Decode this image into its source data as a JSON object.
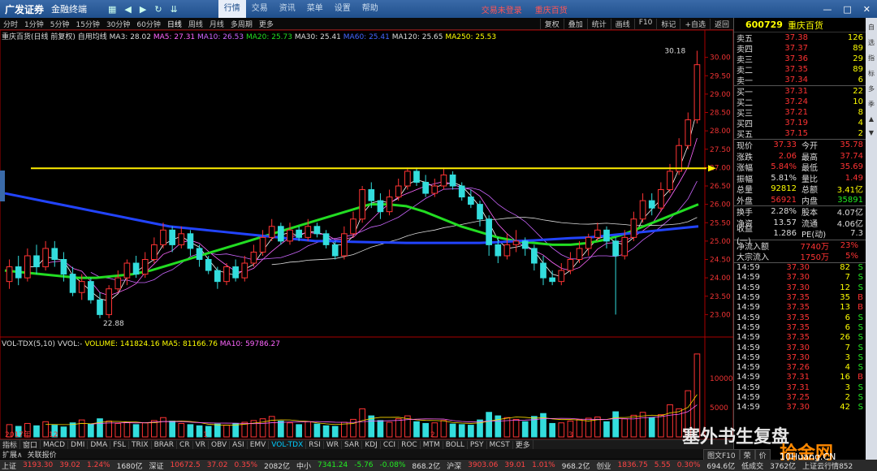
{
  "titlebar": {
    "brand": "广发证券",
    "product": "金融终端",
    "menus": [
      "行情",
      "交易",
      "资讯",
      "菜单",
      "设置",
      "帮助"
    ],
    "notice": "交易未登录",
    "stock": "重庆百货"
  },
  "toolbar": {
    "periods": [
      "分时",
      "1分钟",
      "5分钟",
      "15分钟",
      "30分钟",
      "60分钟",
      "日线",
      "周线",
      "月线",
      "多周期",
      "更多"
    ],
    "actions": [
      "复权",
      "叠加",
      "统计",
      "画线",
      "F10",
      "标记",
      "+自选",
      "返回"
    ]
  },
  "main_header": {
    "name": "重庆百货(日线 前复权)",
    "indicator": "自用均线",
    "ma3": "MA3: 28.02",
    "ma5": "MA5: 27.31",
    "ma10": "MA10: 26.53",
    "ma20": "MA20: 25.73",
    "ma30": "MA30: 25.41",
    "ma60": "MA60: 25.41",
    "ma120": "MA120: 25.65",
    "ma250": "MA250: 25.53"
  },
  "vol_header": {
    "name": "VOL-TDX(5,10)",
    "vvol": "VVOL:-",
    "volume": "VOLUME: 141824.16",
    "ma5": "MA5: 81166.76",
    "ma10": "MA10: 59786.27"
  },
  "chart_data": {
    "type": "candlestick",
    "ylim": [
      22.5,
      30.5
    ],
    "yticks": [
      "30.00",
      "29.50",
      "29.00",
      "28.50",
      "28.00",
      "27.50",
      "27.00",
      "26.50",
      "26.00",
      "25.50",
      "25.00",
      "24.50",
      "24.00",
      "23.50",
      "23.00"
    ],
    "high_label": "30.18",
    "low_label": "22.88",
    "price_line": 26.98,
    "vol_yticks": [
      "10000",
      "5000"
    ],
    "x_labels": [
      "2017年",
      "12",
      "1",
      "2",
      "3"
    ],
    "candles": [
      [
        23.9,
        24.3,
        24.5,
        23.7
      ],
      [
        24.3,
        24.0,
        24.6,
        23.8
      ],
      [
        24.0,
        24.6,
        24.8,
        23.9
      ],
      [
        24.6,
        24.3,
        24.9,
        24.1
      ],
      [
        24.3,
        24.8,
        25.0,
        24.2
      ],
      [
        24.8,
        24.5,
        25.0,
        24.3
      ],
      [
        24.5,
        24.1,
        24.7,
        23.9
      ],
      [
        24.1,
        23.6,
        24.3,
        23.5
      ],
      [
        23.6,
        23.9,
        24.1,
        23.4
      ],
      [
        23.9,
        23.4,
        24.0,
        23.3
      ],
      [
        23.4,
        23.0,
        23.6,
        22.9
      ],
      [
        23.0,
        23.7,
        23.8,
        22.9
      ],
      [
        23.7,
        24.0,
        24.2,
        23.6
      ],
      [
        24.0,
        24.4,
        24.5,
        23.8
      ],
      [
        24.4,
        24.1,
        24.6,
        24.0
      ],
      [
        24.1,
        24.5,
        24.7,
        24.0
      ],
      [
        24.5,
        24.9,
        25.1,
        24.4
      ],
      [
        24.9,
        25.3,
        25.5,
        24.8
      ],
      [
        25.3,
        24.9,
        25.4,
        24.7
      ],
      [
        24.9,
        25.2,
        25.4,
        24.8
      ],
      [
        25.2,
        24.8,
        25.3,
        24.6
      ],
      [
        24.8,
        24.5,
        24.9,
        24.3
      ],
      [
        24.5,
        24.2,
        24.6,
        24.1
      ],
      [
        24.2,
        23.9,
        24.3,
        23.7
      ],
      [
        23.9,
        24.3,
        24.4,
        23.8
      ],
      [
        24.3,
        24.0,
        24.5,
        23.9
      ],
      [
        24.0,
        24.4,
        24.6,
        23.9
      ],
      [
        24.4,
        24.7,
        24.9,
        24.3
      ],
      [
        24.7,
        25.1,
        25.3,
        24.6
      ],
      [
        25.1,
        25.4,
        25.6,
        25.0
      ],
      [
        25.4,
        25.0,
        25.5,
        24.9
      ],
      [
        25.0,
        25.3,
        25.5,
        24.9
      ],
      [
        25.3,
        25.1,
        25.4,
        25.0
      ],
      [
        25.1,
        25.4,
        25.6,
        25.0
      ],
      [
        25.4,
        25.2,
        25.5,
        25.1
      ],
      [
        25.2,
        24.9,
        25.3,
        24.8
      ],
      [
        24.9,
        24.6,
        25.0,
        24.5
      ],
      [
        24.6,
        25.2,
        25.4,
        24.5
      ],
      [
        25.2,
        25.6,
        25.8,
        25.1
      ],
      [
        25.6,
        26.4,
        26.5,
        25.5
      ],
      [
        26.4,
        26.1,
        26.6,
        25.9
      ],
      [
        26.1,
        25.8,
        26.3,
        25.6
      ],
      [
        25.8,
        26.2,
        26.4,
        25.7
      ],
      [
        26.2,
        26.5,
        26.7,
        26.1
      ],
      [
        26.5,
        26.9,
        27.0,
        26.4
      ],
      [
        26.9,
        26.6,
        27.0,
        26.5
      ],
      [
        26.6,
        26.3,
        26.8,
        26.2
      ],
      [
        26.3,
        26.5,
        26.7,
        26.2
      ],
      [
        26.5,
        26.8,
        27.0,
        26.4
      ],
      [
        26.8,
        26.5,
        26.9,
        26.4
      ],
      [
        26.5,
        26.2,
        26.6,
        26.1
      ],
      [
        26.2,
        26.0,
        26.4,
        25.9
      ],
      [
        26.0,
        25.6,
        26.1,
        25.4
      ],
      [
        25.6,
        24.9,
        25.7,
        24.6
      ],
      [
        24.9,
        24.6,
        25.1,
        24.4
      ],
      [
        24.6,
        24.9,
        25.2,
        24.5
      ],
      [
        24.9,
        25.0,
        25.3,
        24.7
      ],
      [
        25.0,
        24.8,
        25.1,
        24.6
      ],
      [
        24.8,
        24.4,
        24.9,
        24.2
      ],
      [
        24.4,
        24.0,
        24.6,
        23.8
      ],
      [
        24.0,
        23.9,
        24.2,
        23.8
      ],
      [
        23.9,
        24.2,
        24.4,
        23.8
      ],
      [
        24.2,
        24.5,
        24.7,
        24.1
      ],
      [
        24.5,
        24.8,
        25.0,
        24.4
      ],
      [
        24.8,
        25.1,
        25.2,
        24.6
      ],
      [
        25.1,
        25.3,
        25.5,
        25.0
      ],
      [
        25.3,
        25.0,
        25.4,
        24.8
      ],
      [
        25.0,
        24.6,
        25.1,
        23.0
      ],
      [
        24.6,
        25.1,
        25.3,
        24.5
      ],
      [
        25.1,
        25.6,
        25.8,
        25.0
      ],
      [
        25.6,
        26.1,
        26.3,
        25.5
      ],
      [
        26.1,
        25.9,
        26.3,
        25.7
      ],
      [
        25.9,
        26.4,
        26.6,
        25.8
      ],
      [
        26.4,
        26.9,
        27.1,
        26.3
      ],
      [
        26.9,
        27.6,
        27.8,
        26.8
      ],
      [
        27.6,
        28.3,
        28.5,
        27.5
      ],
      [
        28.3,
        29.8,
        30.18,
        28.2
      ]
    ],
    "volumes": [
      2100,
      1800,
      2300,
      1900,
      2600,
      2000,
      1700,
      2400,
      2900,
      2200,
      3100,
      2700,
      2300,
      2500,
      2100,
      2400,
      2800,
      3300,
      2700,
      2300,
      2100,
      1900,
      1800,
      2200,
      2000,
      2300,
      2500,
      2800,
      3100,
      3500,
      2700,
      2400,
      2100,
      2600,
      2200,
      1900,
      1800,
      2500,
      3000,
      4800,
      3600,
      2800,
      2500,
      3100,
      3600,
      2600,
      2300,
      2400,
      2800,
      2200,
      2100,
      2000,
      2900,
      4200,
      3600,
      3300,
      3000,
      2600,
      3500,
      4000,
      2300,
      2400,
      2700,
      3000,
      3200,
      3400,
      2600,
      4300,
      3100,
      3700,
      4200,
      3300,
      3800,
      5500,
      4800,
      7900,
      14182
    ],
    "ma_lines": [
      {
        "name": "MA5",
        "color": "#ffffff"
      },
      {
        "name": "MA20",
        "color": "#22dd22",
        "values": [
          24.2,
          24.15,
          24.1,
          24.05,
          24.0,
          24.0,
          24.05,
          24.1,
          24.2,
          24.35,
          24.5,
          24.65,
          24.8,
          24.95,
          25.1,
          25.25,
          25.4,
          25.55,
          25.7,
          25.85,
          26.0,
          26.0,
          25.95,
          25.8,
          25.6,
          25.4,
          25.25,
          25.1,
          25.0,
          24.95,
          24.9,
          24.9,
          24.95,
          25.05,
          25.2,
          25.4,
          25.6,
          25.8,
          26.0
        ]
      },
      {
        "name": "MA250",
        "color": "#2244ff",
        "values": [
          26.3,
          26.2,
          26.1,
          26.0,
          25.9,
          25.8,
          25.7,
          25.6,
          25.5,
          25.4,
          25.35,
          25.3,
          25.25,
          25.2,
          25.15,
          25.1,
          25.05,
          25.0,
          25.0,
          24.98,
          24.97,
          24.96,
          24.95,
          24.95,
          24.95,
          24.95,
          24.95,
          24.97,
          25.0,
          25.02,
          25.05,
          25.08,
          25.1,
          25.15,
          25.2,
          25.25,
          25.3,
          25.35,
          25.4
        ]
      }
    ]
  },
  "quote": {
    "code": "600729",
    "name": "重庆百货",
    "sell": [
      [
        "卖五",
        "37.38",
        "126"
      ],
      [
        "卖四",
        "37.37",
        "89"
      ],
      [
        "卖三",
        "37.36",
        "29"
      ],
      [
        "卖二",
        "37.35",
        "89"
      ],
      [
        "卖一",
        "37.34",
        "6"
      ]
    ],
    "buy": [
      [
        "买一",
        "37.31",
        "22"
      ],
      [
        "买二",
        "37.24",
        "10"
      ],
      [
        "买三",
        "37.21",
        "8"
      ],
      [
        "买四",
        "37.19",
        "4"
      ],
      [
        "买五",
        "37.15",
        "2"
      ]
    ],
    "stats": [
      [
        "现价",
        "37.33",
        "今开",
        "35.78"
      ],
      [
        "涨跌",
        "2.06",
        "最高",
        "37.74"
      ],
      [
        "涨幅",
        "5.84%",
        "最低",
        "35.69"
      ],
      [
        "振幅",
        "5.81%",
        "量比",
        "1.49"
      ],
      [
        "总量",
        "92812",
        "总额",
        "3.41亿"
      ],
      [
        "外盘",
        "56921",
        "内盘",
        "35891"
      ]
    ],
    "stats2": [
      [
        "换手",
        "2.28%",
        "股本",
        "4.07亿"
      ],
      [
        "净资",
        "13.57",
        "流通",
        "4.06亿"
      ],
      [
        "收益(一)",
        "1.286",
        "PE(动)",
        "7.3"
      ]
    ],
    "flow": [
      [
        "净流入额",
        "7740万",
        "23%"
      ],
      [
        "大宗流入",
        "1750万",
        "5%"
      ]
    ],
    "ticks": [
      [
        "14:59",
        "37.30",
        "82",
        "S"
      ],
      [
        "14:59",
        "37.30",
        "7",
        "S"
      ],
      [
        "14:59",
        "37.30",
        "12",
        "S"
      ],
      [
        "14:59",
        "37.35",
        "35",
        "B"
      ],
      [
        "14:59",
        "37.35",
        "13",
        "B"
      ],
      [
        "14:59",
        "37.35",
        "6",
        "S"
      ],
      [
        "14:59",
        "37.35",
        "6",
        "S"
      ],
      [
        "14:59",
        "37.35",
        "26",
        "S"
      ],
      [
        "14:59",
        "37.30",
        "7",
        "S"
      ],
      [
        "14:59",
        "37.30",
        "3",
        "S"
      ],
      [
        "14:59",
        "37.26",
        "4",
        "S"
      ],
      [
        "14:59",
        "37.31",
        "16",
        "B"
      ],
      [
        "14:59",
        "37.31",
        "3",
        "S"
      ],
      [
        "14:59",
        "37.25",
        "2",
        "S"
      ],
      [
        "14:59",
        "37.30",
        "42",
        "S"
      ]
    ]
  },
  "indicators": [
    "指标",
    "窗口",
    "MACD",
    "DMI",
    "DMA",
    "FSL",
    "TRIX",
    "BRAR",
    "CR",
    "VR",
    "OBV",
    "ASI",
    "EMV",
    "VOL-TDX",
    "RSI",
    "WR",
    "SAR",
    "KDJ",
    "CCI",
    "ROC",
    "MTM",
    "BOLL",
    "PSY",
    "MCST",
    "更多"
  ],
  "ext_tabs": [
    "扩展∧",
    "关联报价"
  ],
  "status": {
    "sh": "上证",
    "sh_v": "3193.30",
    "sh_c": "39.02",
    "sh_p": "1.24%",
    "sh_a": "1680亿",
    "sz": "深证",
    "sz_v": "10672.5",
    "sz_c": "37.02",
    "sz_p": "0.35%",
    "sz_a": "2082亿",
    "zx": "中小",
    "zx_v": "7341.24",
    "zx_c": "-5.76",
    "zx_p": "-0.08%",
    "zx_a": "868.2亿",
    "hs": "沪深",
    "hs_v": "3903.06",
    "hs_c": "39.01",
    "hs_p": "1.01%",
    "hs_a": "968.2亿",
    "cy": "创业",
    "cy_v": "1836.75",
    "cy_c": "5.55",
    "cy_p": "0.30%",
    "cy_a": "694.6亿",
    "misc1": "低成交",
    "misc2": "3762亿",
    "misc3": "上证云行情852"
  },
  "side_tabs": [
    "自",
    "选",
    "指",
    "标",
    "多",
    "季",
    "▲",
    "▼"
  ],
  "right_tabs": [
    "图文F10",
    "荣",
    "价"
  ],
  "watermark": {
    "text1": "塞外书生复盘",
    "text2": "拾金网",
    "text3": "10Huang.CN"
  }
}
